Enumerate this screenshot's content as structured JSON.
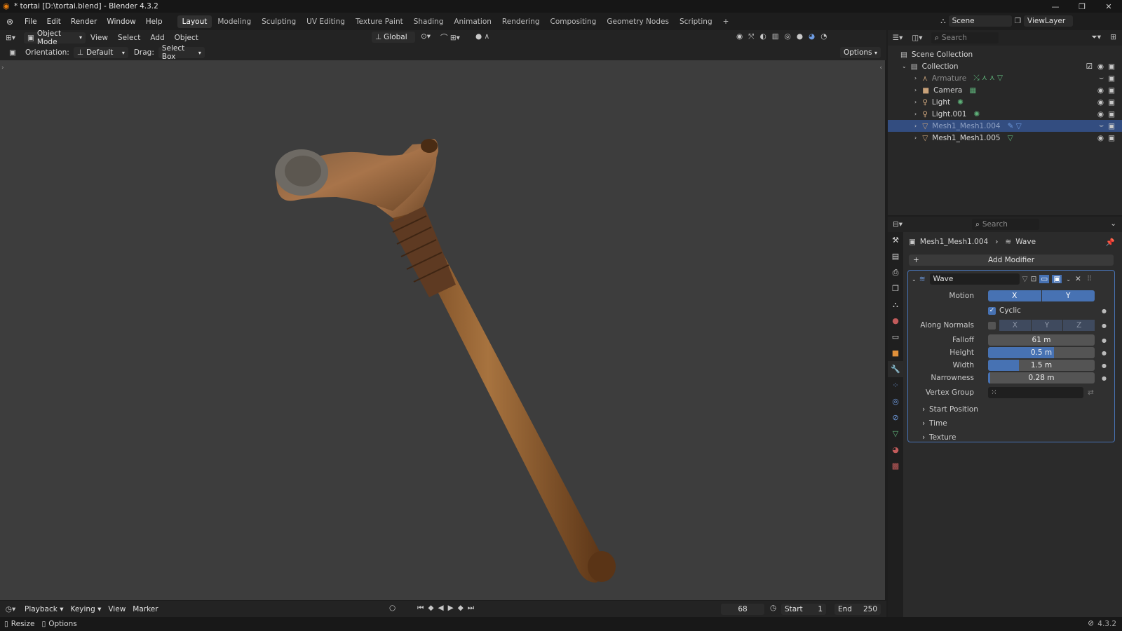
{
  "window": {
    "title": "* tortai [D:\\tortai.blend] - Blender 4.3.2",
    "controls": [
      "—",
      "❐",
      "✕"
    ]
  },
  "menu": {
    "items": [
      "File",
      "Edit",
      "Render",
      "Window",
      "Help"
    ]
  },
  "workspaces": [
    "Layout",
    "Modeling",
    "Sculpting",
    "UV Editing",
    "Texture Paint",
    "Shading",
    "Animation",
    "Rendering",
    "Compositing",
    "Geometry Nodes",
    "Scripting"
  ],
  "top_right": {
    "scene": "Scene",
    "view_layer": "ViewLayer"
  },
  "header": {
    "mode": "Object Mode",
    "menu": [
      "View",
      "Select",
      "Add",
      "Object"
    ],
    "transform": "Global"
  },
  "tool_header": {
    "orientation_label": "Orientation:",
    "orientation": "Default",
    "drag_label": "Drag:",
    "drag": "Select Box",
    "options": "Options"
  },
  "outliner": {
    "search_placeholder": "Search",
    "scene_collection": "Scene Collection",
    "collection": "Collection",
    "items": [
      {
        "name": "Armature",
        "icon": "armature-icon",
        "dim": true,
        "color": "#c9a27a"
      },
      {
        "name": "Camera",
        "icon": "camera-icon",
        "dim": false,
        "color": "#c9a27a"
      },
      {
        "name": "Light",
        "icon": "light-icon",
        "dim": false,
        "color": "#c9a27a"
      },
      {
        "name": "Light.001",
        "icon": "light-icon",
        "dim": false,
        "color": "#c9a27a"
      },
      {
        "name": "Mesh1_Mesh1.004",
        "icon": "mesh-icon",
        "dim": true,
        "selected": true,
        "color": "#c9a27a"
      },
      {
        "name": "Mesh1_Mesh1.005",
        "icon": "mesh-icon",
        "dim": false,
        "color": "#c9a27a"
      }
    ]
  },
  "properties": {
    "search_placeholder": "Search",
    "breadcrumb_object": "Mesh1_Mesh1.004",
    "breadcrumb_modifier": "Wave",
    "add_modifier": "Add Modifier",
    "modifier_name": "Wave",
    "motion_label": "Motion",
    "motion_x": "X",
    "motion_y": "Y",
    "cyclic_label": "Cyclic",
    "cyclic_checked": true,
    "along_normals_label": "Along Normals",
    "normals_x": "X",
    "normals_y": "Y",
    "normals_z": "Z",
    "falloff_label": "Falloff",
    "falloff": "61 m",
    "height_label": "Height",
    "height": "0.5 m",
    "height_fill": 0.62,
    "width_label": "Width",
    "width": "1.5 m",
    "width_fill": 0.29,
    "narrowness_label": "Narrowness",
    "narrowness": "0.28 m",
    "narrowness_fill": 0.02,
    "vertex_group_label": "Vertex Group",
    "sub_panels": [
      "Start Position",
      "Time",
      "Texture"
    ]
  },
  "timeline": {
    "menus": [
      "Playback",
      "Keying",
      "View",
      "Marker"
    ],
    "current_frame": "68",
    "start_label": "Start",
    "start": "1",
    "end_label": "End",
    "end": "250"
  },
  "status": {
    "left": [
      "Resize",
      "Options"
    ],
    "version": "4.3.2"
  },
  "colors": {
    "accent": "#4772b3",
    "selection": "#334d80",
    "viewport_bg": "#3d3d3d",
    "wood": "#8a5a2e"
  }
}
